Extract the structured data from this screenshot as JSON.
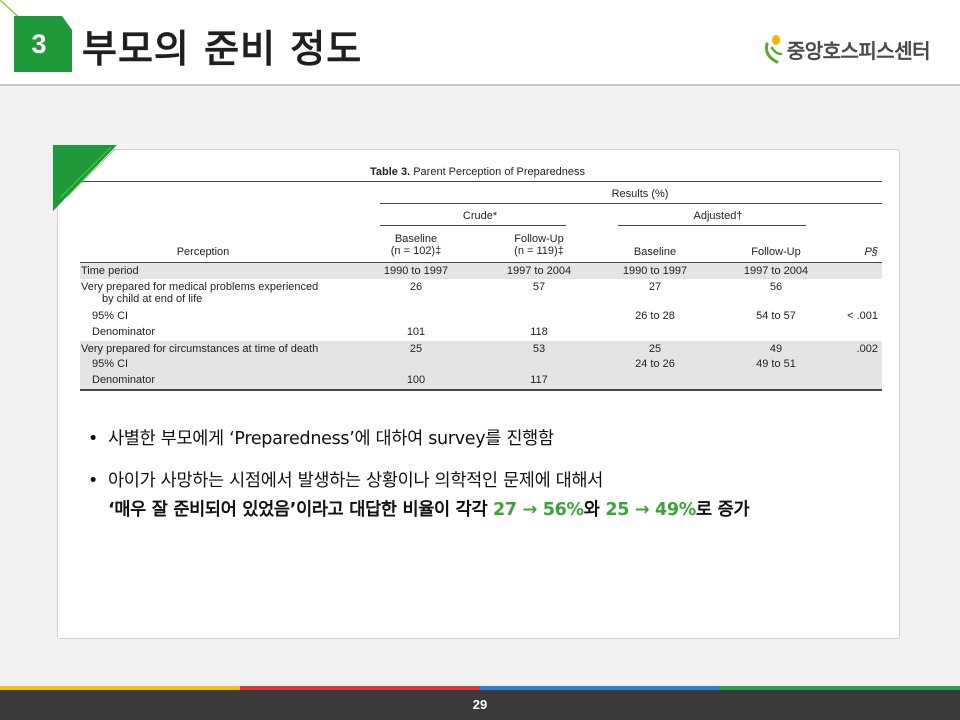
{
  "header": {
    "badge_number": "3",
    "title": "부모의 준비 정도",
    "logo_text": "중앙호스피스센터"
  },
  "table": {
    "caption_bold": "Table 3.",
    "caption_rest": " Parent Perception of Preparedness",
    "results_label": "Results (%)",
    "crude_label": "Crude*",
    "adjusted_label": "Adjusted†",
    "perception_label": "Perception",
    "baseline_crude_line1": "Baseline",
    "baseline_crude_line2": "(n = 102)‡",
    "followup_crude_line1": "Follow-Up",
    "followup_crude_line2": "(n = 119)‡",
    "baseline_adj": "Baseline",
    "followup_adj": "Follow-Up",
    "p_label": "P§",
    "rows": [
      {
        "perception": "Time period",
        "c1": "1990 to 1997",
        "c2": "1997 to 2004",
        "c3": "1990 to 1997",
        "c4": "1997 to 2004",
        "p": ""
      },
      {
        "perception": "Very prepared for medical problems experienced",
        "perception2": "by child at end of life",
        "c1": "26",
        "c2": "57",
        "c3": "27",
        "c4": "56",
        "p": ""
      },
      {
        "perception": "95% CI",
        "c1": "",
        "c2": "",
        "c3": "26 to 28",
        "c4": "54 to 57",
        "p": "< .001"
      },
      {
        "perception": "Denominator",
        "c1": "101",
        "c2": "118",
        "c3": "",
        "c4": "",
        "p": ""
      },
      {
        "perception": "Very prepared for circumstances at time of death",
        "c1": "25",
        "c2": "53",
        "c3": "25",
        "c4": "49",
        "p": ".002"
      },
      {
        "perception": "95% CI",
        "c1": "",
        "c2": "",
        "c3": "24 to 26",
        "c4": "49 to 51",
        "p": ""
      },
      {
        "perception": "Denominator",
        "c1": "100",
        "c2": "117",
        "c3": "",
        "c4": "",
        "p": ""
      }
    ]
  },
  "bullets": {
    "bullet1": "사별한 부모에게 ‘Preparedness’에 대하여 survey를 진행함",
    "bullet2": "아이가 사망하는 시점에서 발생하는 상황이나 의학적인 문제에 대해서",
    "emph_part1": "‘매우 잘 준비되어 있었음’이라고 대답한 비율이 각각 ",
    "emph_green1": "27 → 56%",
    "emph_part2": "와 ",
    "emph_green2": "25 → 49%",
    "emph_part3": "로 증가"
  },
  "footer": {
    "page_number": "29"
  },
  "colors": {
    "brand_green": "#1e9a3a",
    "highlight_green": "#3aa535",
    "footer_bg": "#3a3a3a",
    "stripe_yellow": "#f2c200",
    "stripe_red": "#d23a3a",
    "stripe_blue": "#2f7fd0",
    "stripe_green": "#2aa048"
  }
}
